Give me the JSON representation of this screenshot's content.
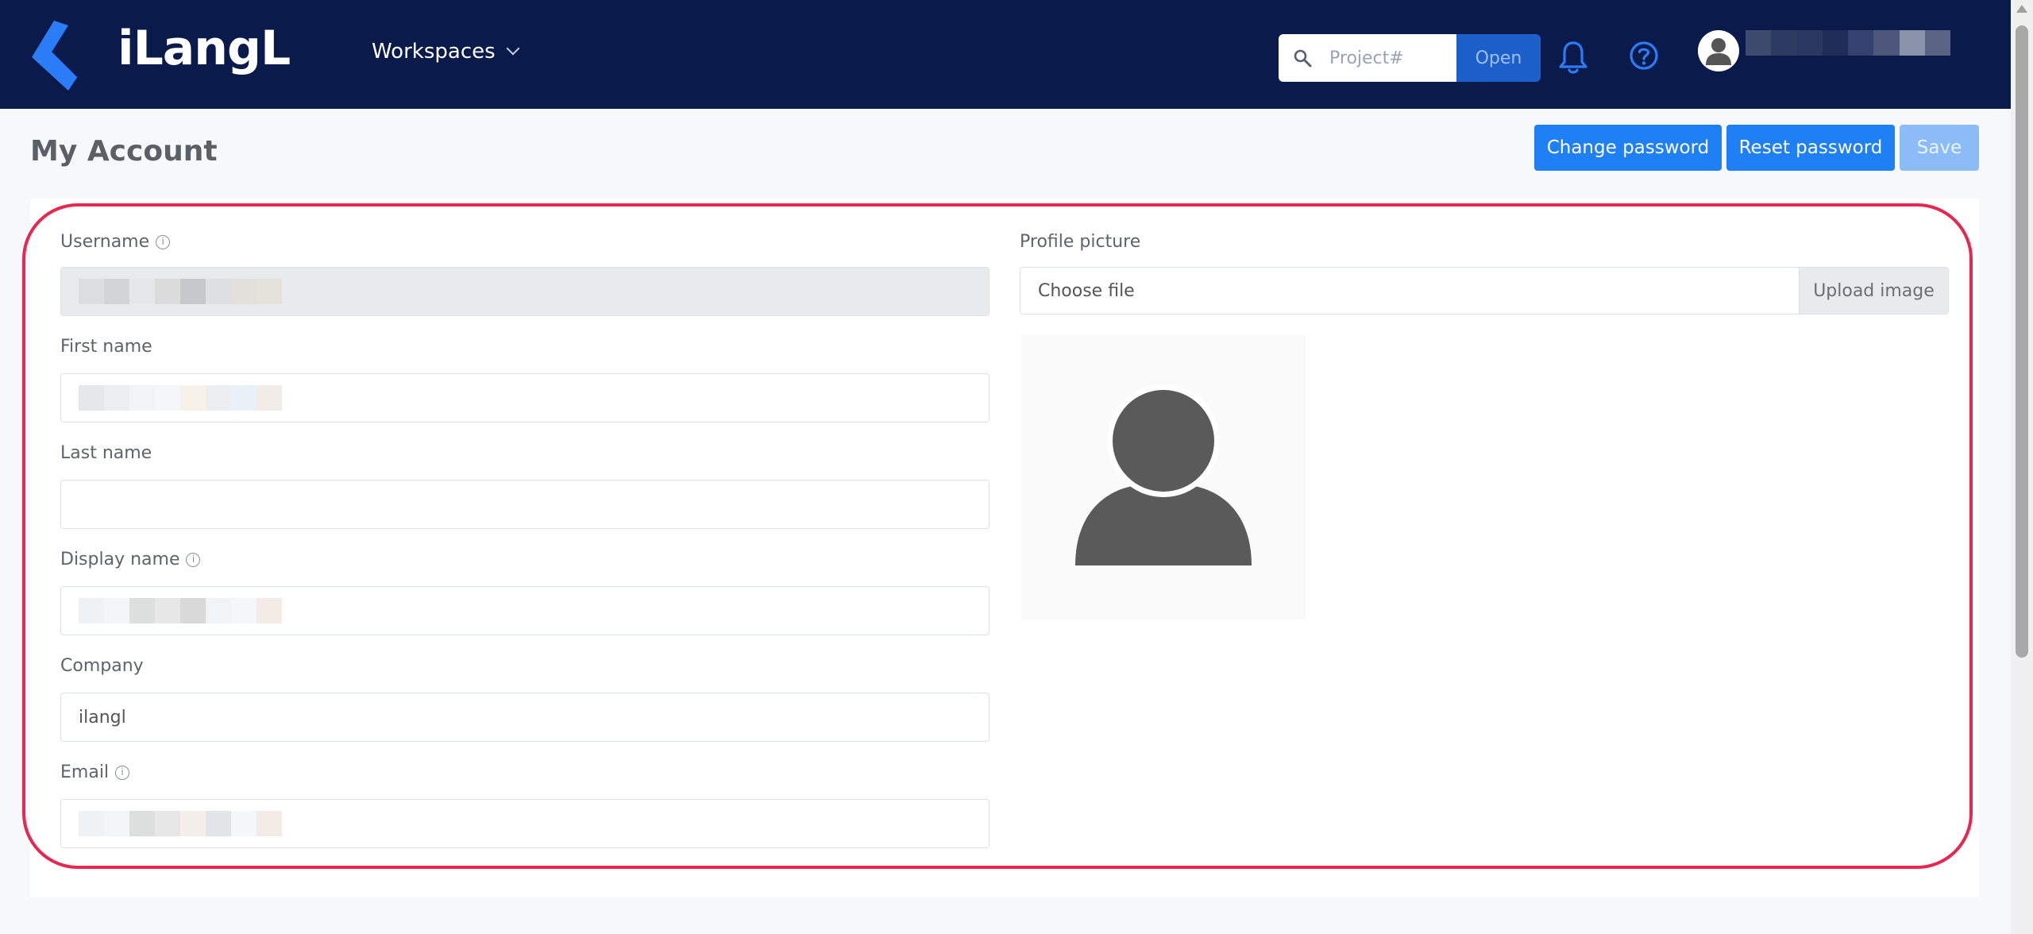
{
  "brand": {
    "name": "iLangL"
  },
  "nav": {
    "workspaces_label": "Workspaces"
  },
  "search": {
    "placeholder": "Project#",
    "open_label": "Open"
  },
  "page": {
    "title": "My Account"
  },
  "actions": {
    "change_password": "Change password",
    "reset_password": "Reset password",
    "save": "Save"
  },
  "form": {
    "username_label": "Username",
    "first_name_label": "First name",
    "last_name_label": "Last name",
    "last_name_value": "",
    "display_name_label": "Display name",
    "company_label": "Company",
    "company_value": "ilangl",
    "email_label": "Email"
  },
  "profile": {
    "label": "Profile picture",
    "choose_file": "Choose file",
    "upload_label": "Upload image"
  },
  "colors": {
    "nav_bg": "#0a1a4a",
    "primary": "#1f7ff5",
    "highlight": "#e8264f"
  },
  "icons": [
    "search-icon",
    "chevron-down-icon",
    "bell-icon",
    "help-icon",
    "user-icon",
    "info-icon",
    "default-avatar-icon"
  ]
}
